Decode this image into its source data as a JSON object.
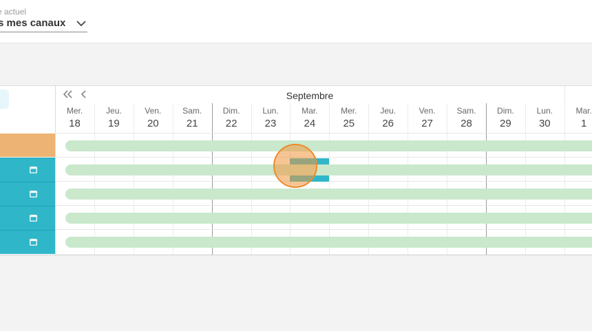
{
  "header": {
    "select_label": "e actuel",
    "select_value": "s mes canaux",
    "chevron_icon": "chevron-down-icon"
  },
  "calendar": {
    "month": "Septembre",
    "days": [
      {
        "name": "Mer.",
        "date": "18"
      },
      {
        "name": "Jeu.",
        "date": "19"
      },
      {
        "name": "Ven.",
        "date": "20"
      },
      {
        "name": "Sam.",
        "date": "21"
      },
      {
        "name": "Dim.",
        "date": "22"
      },
      {
        "name": "Lun.",
        "date": "23"
      },
      {
        "name": "Mar.",
        "date": "24"
      },
      {
        "name": "Mer.",
        "date": "25"
      },
      {
        "name": "Jeu.",
        "date": "26"
      },
      {
        "name": "Ven.",
        "date": "27"
      },
      {
        "name": "Sam.",
        "date": "28"
      },
      {
        "name": "Dim.",
        "date": "29"
      },
      {
        "name": "Lun.",
        "date": "30"
      },
      {
        "name": "Mar.",
        "date": "1"
      }
    ],
    "nav_icons": [
      "double-chevron-left-icon",
      "chevron-left-icon"
    ],
    "row_icon": "calendar-icon",
    "colors": {
      "orange_row": "#ecb374",
      "teal_row": "#2fb7c9",
      "availability_bar": "#c9e8cc",
      "reservation": "#2fb7c9"
    }
  }
}
